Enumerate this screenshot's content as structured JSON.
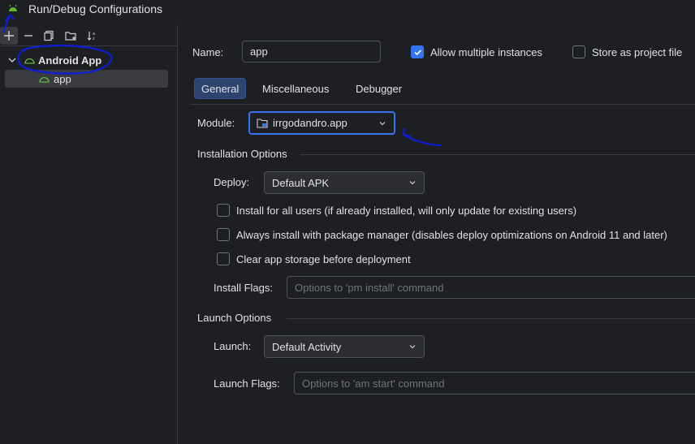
{
  "window": {
    "title": "Run/Debug Configurations"
  },
  "toolbar": {
    "buttons": [
      "plus-icon",
      "minus-icon",
      "copy-icon",
      "folder-icon",
      "sort-icon"
    ]
  },
  "tree": {
    "group_label": "Android App",
    "item_label": "app"
  },
  "form": {
    "name_label": "Name:",
    "name_value": "app",
    "allow_multiple_label": "Allow multiple instances",
    "allow_multiple_checked": true,
    "store_as_file_label": "Store as project file",
    "store_as_file_checked": false
  },
  "tabs": [
    {
      "label": "General",
      "selected": true
    },
    {
      "label": "Miscellaneous",
      "selected": false
    },
    {
      "label": "Debugger",
      "selected": false
    }
  ],
  "module": {
    "label": "Module:",
    "value": "irrgodandro.app"
  },
  "installation": {
    "section_title": "Installation Options",
    "deploy_label": "Deploy:",
    "deploy_value": "Default APK",
    "options": [
      {
        "label": "Install for all users (if already installed, will only update for existing users)",
        "checked": false
      },
      {
        "label": "Always install with package manager (disables deploy optimizations on Android 11 and later)",
        "checked": false
      },
      {
        "label": "Clear app storage before deployment",
        "checked": false
      }
    ],
    "flags_label": "Install Flags:",
    "flags_placeholder": "Options to 'pm install' command"
  },
  "launch": {
    "section_title": "Launch Options",
    "launch_label": "Launch:",
    "launch_value": "Default Activity",
    "flags_label": "Launch Flags:",
    "flags_placeholder": "Options to 'am start' command"
  },
  "colors": {
    "background": "#1e1f22",
    "accent": "#3574f0",
    "android_green": "#5fb832",
    "annotation_blue": "#0d1fd6"
  }
}
